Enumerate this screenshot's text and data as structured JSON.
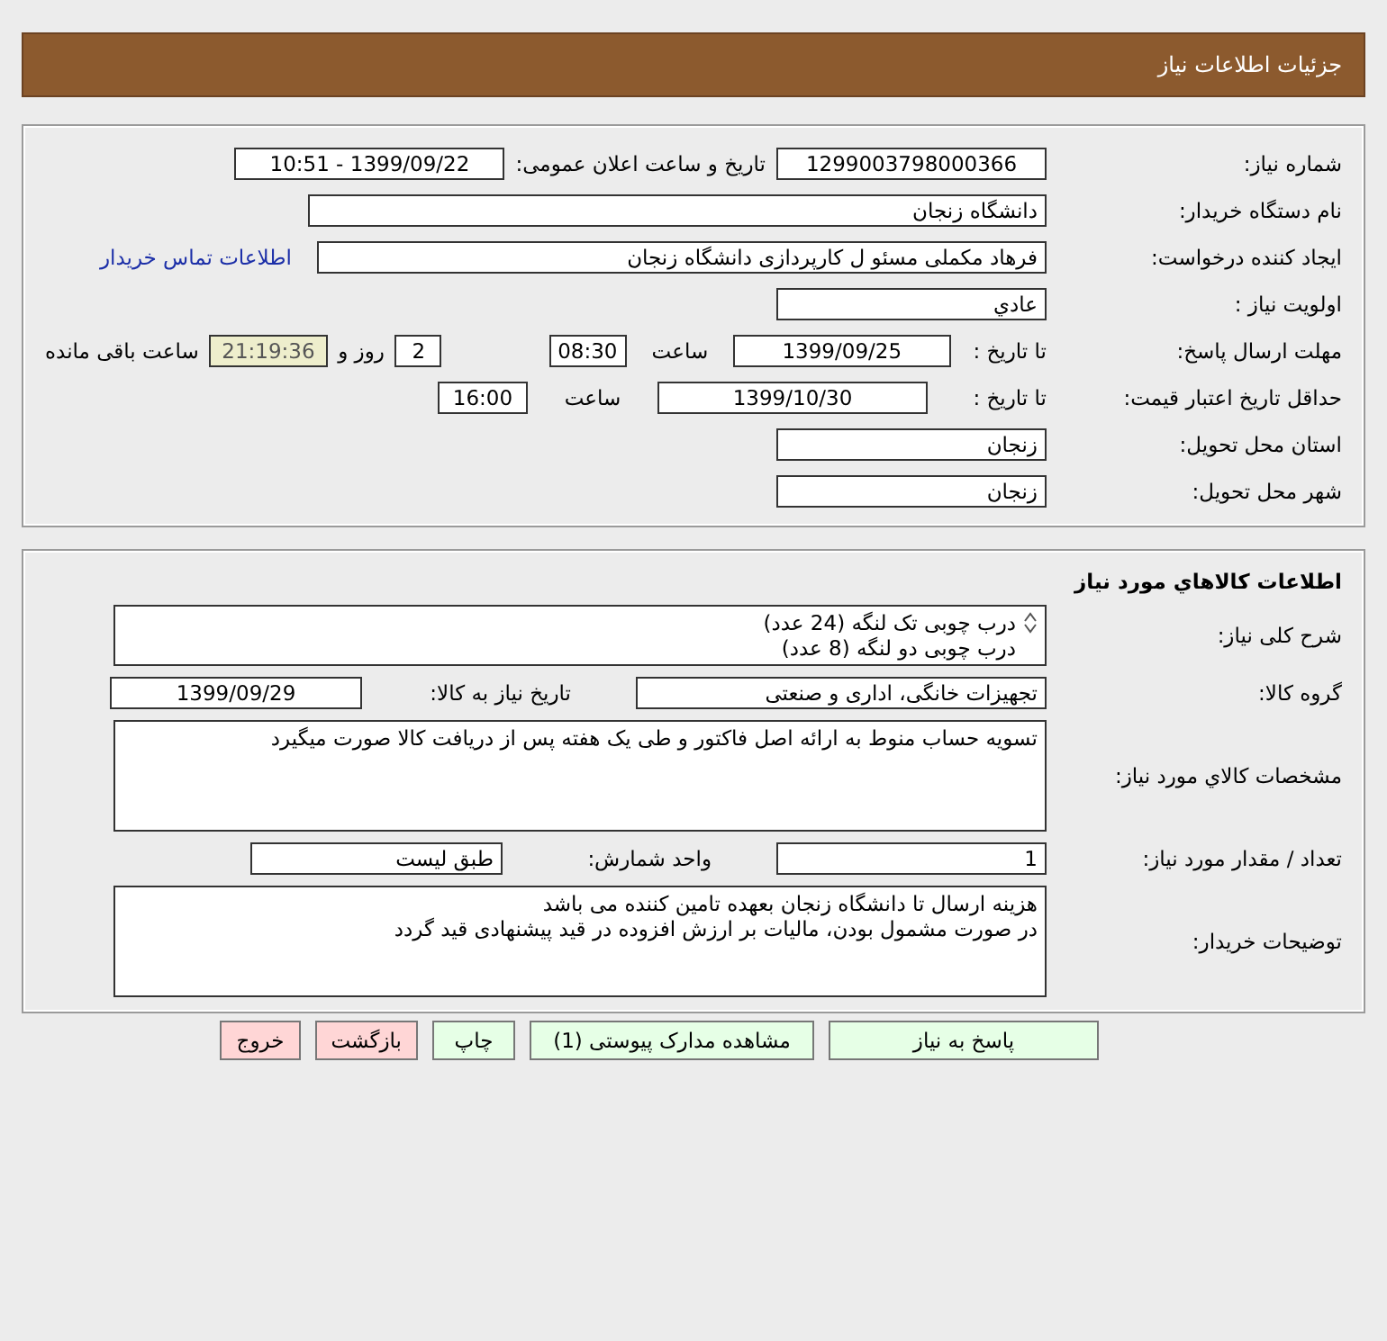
{
  "header": {
    "title": "جزئیات اطلاعات نیاز"
  },
  "need": {
    "number": {
      "label": "شماره نیاز:",
      "value": "1299003798000366"
    },
    "announce": {
      "label": "تاریخ و ساعت اعلان عمومی:",
      "value": "1399/09/22 - 10:51"
    },
    "buyer": {
      "label": "نام دستگاه خریدار:",
      "value": "دانشگاه زنجان"
    },
    "creator": {
      "label": "ایجاد کننده درخواست:",
      "value": "فرهاد مکملی مسئو ل کارپردازی دانشگاه زنجان",
      "link": "اطلاعات تماس خریدار"
    },
    "priority": {
      "label": "اولویت نیاز :",
      "value": "عادي"
    },
    "deadline": {
      "label": "مهلت ارسال پاسخ:",
      "to_label": "تا تاریخ :",
      "date": "1399/09/25",
      "time_label": "ساعت",
      "time": "08:30",
      "days": "2",
      "days_label": "روز و",
      "remaining": "21:19:36",
      "remaining_label": "ساعت باقی مانده"
    },
    "validity": {
      "label": "حداقل تاریخ اعتبار قیمت:",
      "to_label": "تا تاریخ :",
      "date": "1399/10/30",
      "time_label": "ساعت",
      "time": "16:00"
    },
    "province": {
      "label": "استان محل تحویل:",
      "value": "زنجان"
    },
    "city": {
      "label": "شهر محل تحویل:",
      "value": "زنجان"
    }
  },
  "goods": {
    "title": "اطلاعات کالاهاي مورد نياز",
    "description": {
      "label": "شرح کلی نیاز:",
      "lines": [
        "درب چوبی تک لنگه (24 عدد)",
        "درب چوبی دو لنگه (8 عدد)"
      ]
    },
    "group": {
      "label": "گروه کالا:",
      "value": "تجهیزات خانگی، اداری و صنعتی",
      "date_label": "تاریخ نیاز به کالا:",
      "date": "1399/09/29"
    },
    "specs": {
      "label": "مشخصات کالاي مورد نياز:",
      "lines": [
        "تسویه حساب منوط به ارائه اصل فاکتور و طی یک هفته پس از دریافت کالا صورت میگیرد"
      ]
    },
    "quantity": {
      "label": "تعداد / مقدار مورد نیاز:",
      "value": "1",
      "unit_label": "واحد شمارش:",
      "unit": "طبق لیست"
    },
    "notes": {
      "label": "توضیحات خریدار:",
      "lines": [
        "هزینه ارسال تا دانشگاه زنجان بعهده تامین کننده می باشد",
        "در صورت مشمول بودن، مالیات بر ارزش افزوده در قید پیشنهادی قید گردد"
      ]
    }
  },
  "buttons": [
    {
      "label": "پاسخ به نیاز",
      "kind": "action"
    },
    {
      "label": "مشاهده مدارک پیوستی (1)",
      "kind": "action"
    },
    {
      "label": "چاپ",
      "kind": "action"
    },
    {
      "label": "بازگشت",
      "kind": "exit"
    },
    {
      "label": "خروج",
      "kind": "exit"
    }
  ]
}
